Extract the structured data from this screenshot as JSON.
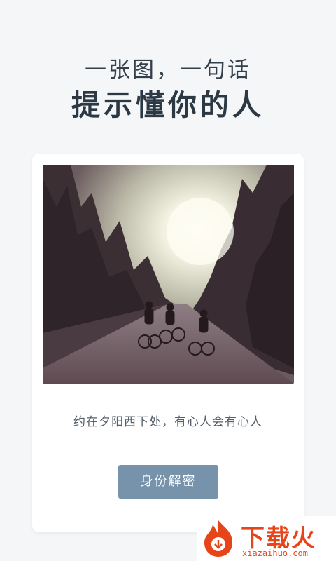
{
  "header": {
    "subtitle": "一张图，一句话",
    "title": "提示懂你的人"
  },
  "card": {
    "image_description": "photo-cyclists-forest-road-sunset",
    "caption": "约在夕阳西下处，有心人会有心人",
    "reveal_button_label": "身份解密"
  },
  "watermark": {
    "brand": "下载火",
    "domain": "xiazaihuo.com"
  },
  "colors": {
    "background": "#f4f6f8",
    "button": "#7793ab",
    "watermark": "#e8441a"
  }
}
